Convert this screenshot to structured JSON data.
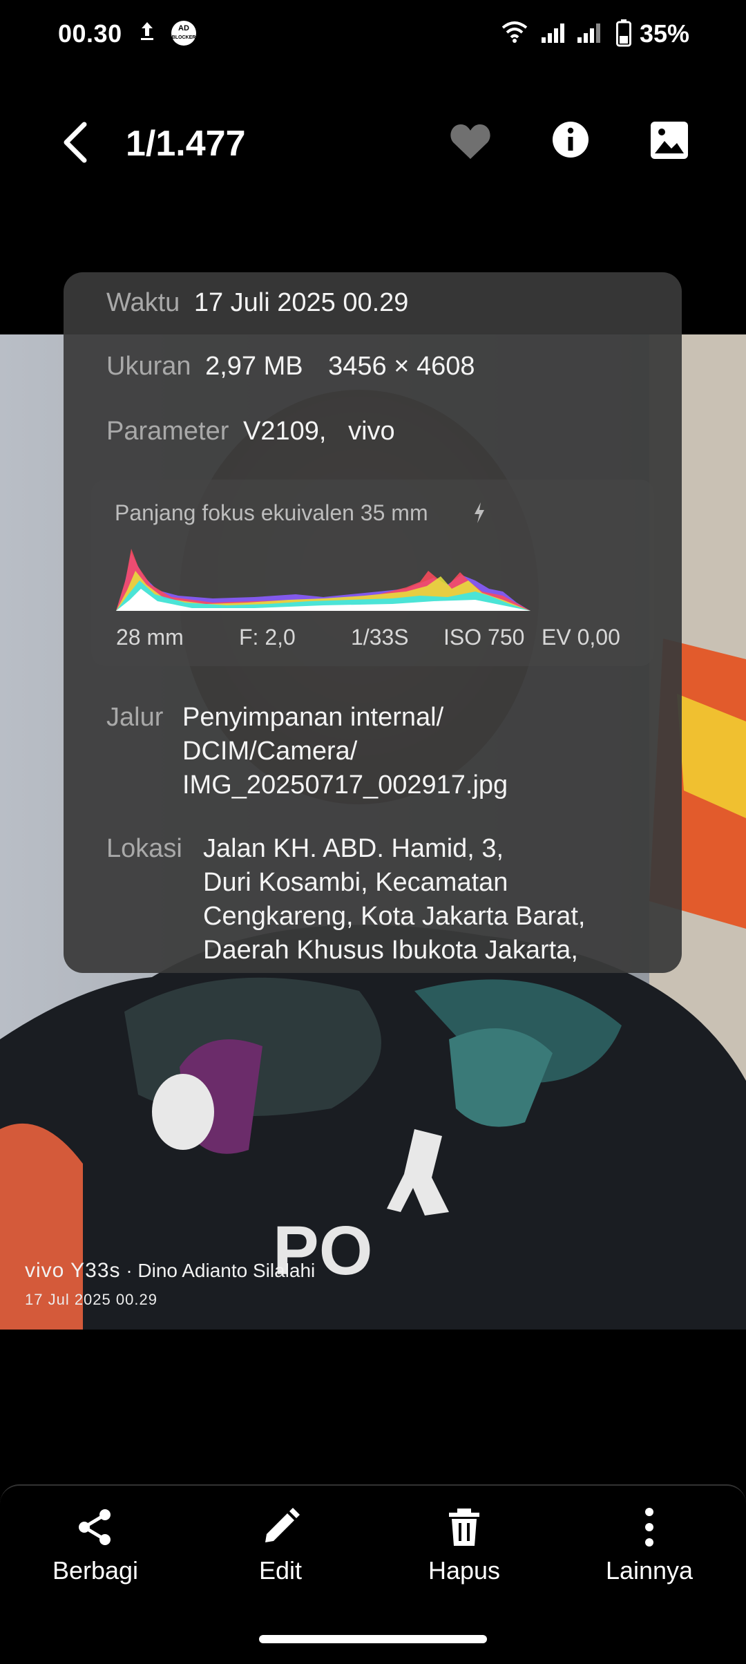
{
  "status_bar": {
    "time": "00.30",
    "adblock_badge": "AD BLOCKER",
    "battery_pct": "35%",
    "icons": [
      "upload-icon",
      "adblocker-icon",
      "wifi-icon",
      "signal-icon",
      "signal-icon",
      "battery-icon"
    ]
  },
  "header": {
    "counter": "1/1.477",
    "icons": [
      "back-arrow-icon",
      "heart-icon",
      "info-icon",
      "image-icon"
    ]
  },
  "info": {
    "time_label": "Waktu",
    "time_value": "17 Juli 2025 00.29",
    "size_label": "Ukuran",
    "size_value": "2,97 MB",
    "resolution": "3456 × 4608",
    "param_label": "Parameter",
    "param_value": "V2109,   vivo",
    "histogram_title": "Panjang fokus ekuivalen 35 mm",
    "exif": {
      "focal": "28 mm",
      "aperture": "F: 2,0",
      "shutter": "1/33S",
      "iso": "ISO 750",
      "ev": "EV 0,00"
    },
    "path_label": "Jalur",
    "path_lines": [
      "Penyimpanan internal/",
      "DCIM/Camera/",
      "IMG_20250717_002917.jpg"
    ],
    "location_label": "Lokasi",
    "location_lines": [
      "Jalan KH. ABD. Hamid, 3,",
      "Duri Kosambi, Kecamatan",
      "Cengkareng, Kota Jakarta Barat,",
      "Daerah Khusus Ibukota Jakarta,"
    ]
  },
  "watermark": {
    "brand": "vivo Y33s",
    "separator": "·",
    "author": "Dino Adianto Silalahi",
    "date": "17 Jul 2025 00.29"
  },
  "actions": {
    "share": "Berbagi",
    "edit": "Edit",
    "delete": "Hapus",
    "more": "Lainnya"
  },
  "colors": {
    "panel_bg": "#3a3a3a",
    "label": "#a9a9a9",
    "value": "#f4f4f4"
  }
}
